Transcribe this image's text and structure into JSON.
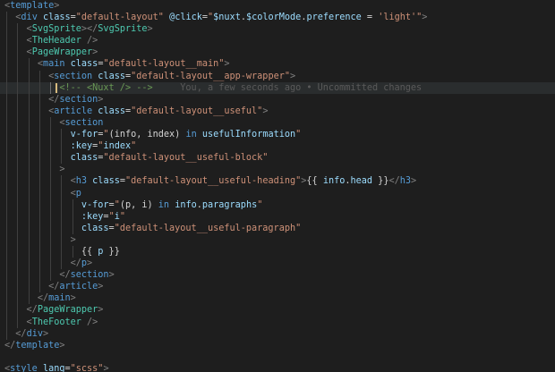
{
  "editor": {
    "lines": [
      {
        "indent": 0,
        "guides": [],
        "tokens": [
          [
            "<",
            "punc"
          ],
          [
            "template",
            "tag"
          ],
          [
            ">",
            "punc"
          ]
        ]
      },
      {
        "indent": 1,
        "guides": [
          0
        ],
        "tokens": [
          [
            "<",
            "punc"
          ],
          [
            "div",
            "tag"
          ],
          [
            " ",
            "txt"
          ],
          [
            "class",
            "attr"
          ],
          [
            "=",
            "txt"
          ],
          [
            "\"default-layout\"",
            "str"
          ],
          [
            " ",
            "txt"
          ],
          [
            "@click",
            "attr"
          ],
          [
            "=",
            "txt"
          ],
          [
            "\"",
            "str"
          ],
          [
            "$nuxt",
            "var"
          ],
          [
            ".",
            "txt"
          ],
          [
            "$colorMode",
            "var"
          ],
          [
            ".",
            "txt"
          ],
          [
            "preference",
            "var"
          ],
          [
            " = ",
            "txt"
          ],
          [
            "'light'",
            "str"
          ],
          [
            "\"",
            "str"
          ],
          [
            ">",
            "punc"
          ]
        ]
      },
      {
        "indent": 2,
        "guides": [
          0,
          1
        ],
        "tokens": [
          [
            "<",
            "punc"
          ],
          [
            "SvgSprite",
            "comp"
          ],
          [
            "></",
            "punc"
          ],
          [
            "SvgSprite",
            "comp"
          ],
          [
            ">",
            "punc"
          ]
        ]
      },
      {
        "indent": 2,
        "guides": [
          0,
          1
        ],
        "tokens": [
          [
            "<",
            "punc"
          ],
          [
            "TheHeader",
            "comp"
          ],
          [
            " />",
            "punc"
          ]
        ]
      },
      {
        "indent": 2,
        "guides": [
          0,
          1
        ],
        "tokens": [
          [
            "<",
            "punc"
          ],
          [
            "PageWrapper",
            "comp"
          ],
          [
            ">",
            "punc"
          ]
        ]
      },
      {
        "indent": 3,
        "guides": [
          0,
          1,
          2
        ],
        "tokens": [
          [
            "<",
            "punc"
          ],
          [
            "main",
            "tag"
          ],
          [
            " ",
            "txt"
          ],
          [
            "class",
            "attr"
          ],
          [
            "=",
            "txt"
          ],
          [
            "\"default-layout__main\"",
            "str"
          ],
          [
            ">",
            "punc"
          ]
        ]
      },
      {
        "indent": 4,
        "guides": [
          0,
          1,
          2,
          3
        ],
        "tokens": [
          [
            "<",
            "punc"
          ],
          [
            "section",
            "tag"
          ],
          [
            " ",
            "txt"
          ],
          [
            "class",
            "attr"
          ],
          [
            "=",
            "txt"
          ],
          [
            "\"default-layout__app-wrapper\"",
            "str"
          ],
          [
            ">",
            "punc"
          ]
        ]
      },
      {
        "indent": 5,
        "guides": [
          0,
          1,
          2,
          3,
          4
        ],
        "current": true,
        "cursor": true,
        "tokens": [
          [
            "<!-- <Nuxt /> -->",
            "cmt"
          ],
          [
            "     You, a few seconds ago • Uncommitted changes",
            "blame"
          ]
        ]
      },
      {
        "indent": 4,
        "guides": [
          0,
          1,
          2,
          3
        ],
        "tokens": [
          [
            "</",
            "punc"
          ],
          [
            "section",
            "tag"
          ],
          [
            ">",
            "punc"
          ]
        ]
      },
      {
        "indent": 4,
        "guides": [
          0,
          1,
          2,
          3
        ],
        "tokens": [
          [
            "<",
            "punc"
          ],
          [
            "article",
            "tag"
          ],
          [
            " ",
            "txt"
          ],
          [
            "class",
            "attr"
          ],
          [
            "=",
            "txt"
          ],
          [
            "\"default-layout__useful\"",
            "str"
          ],
          [
            ">",
            "punc"
          ]
        ]
      },
      {
        "indent": 5,
        "guides": [
          0,
          1,
          2,
          3,
          4
        ],
        "tokens": [
          [
            "<",
            "punc"
          ],
          [
            "section",
            "tag"
          ]
        ]
      },
      {
        "indent": 6,
        "guides": [
          0,
          1,
          2,
          3,
          4,
          5
        ],
        "tokens": [
          [
            "v-for",
            "attr"
          ],
          [
            "=",
            "txt"
          ],
          [
            "\"",
            "str"
          ],
          [
            "(info, index) ",
            "txt"
          ],
          [
            "in",
            "kw"
          ],
          [
            " ",
            "txt"
          ],
          [
            "usefulInformation",
            "var"
          ],
          [
            "\"",
            "str"
          ]
        ]
      },
      {
        "indent": 6,
        "guides": [
          0,
          1,
          2,
          3,
          4,
          5
        ],
        "tokens": [
          [
            ":key",
            "attr"
          ],
          [
            "=",
            "txt"
          ],
          [
            "\"",
            "str"
          ],
          [
            "index",
            "var"
          ],
          [
            "\"",
            "str"
          ]
        ]
      },
      {
        "indent": 6,
        "guides": [
          0,
          1,
          2,
          3,
          4,
          5
        ],
        "tokens": [
          [
            "class",
            "attr"
          ],
          [
            "=",
            "txt"
          ],
          [
            "\"default-layout__useful-block\"",
            "str"
          ]
        ]
      },
      {
        "indent": 5,
        "guides": [
          0,
          1,
          2,
          3,
          4
        ],
        "tokens": [
          [
            ">",
            "punc"
          ]
        ]
      },
      {
        "indent": 6,
        "guides": [
          0,
          1,
          2,
          3,
          4,
          5
        ],
        "tokens": [
          [
            "<",
            "punc"
          ],
          [
            "h3",
            "tag"
          ],
          [
            " ",
            "txt"
          ],
          [
            "class",
            "attr"
          ],
          [
            "=",
            "txt"
          ],
          [
            "\"default-layout__useful-heading\"",
            "str"
          ],
          [
            ">",
            "punc"
          ],
          [
            "{{ ",
            "txt"
          ],
          [
            "info",
            "var"
          ],
          [
            ".",
            "txt"
          ],
          [
            "head",
            "var"
          ],
          [
            " }}",
            "txt"
          ],
          [
            "</",
            "punc"
          ],
          [
            "h3",
            "tag"
          ],
          [
            ">",
            "punc"
          ]
        ]
      },
      {
        "indent": 6,
        "guides": [
          0,
          1,
          2,
          3,
          4,
          5
        ],
        "tokens": [
          [
            "<",
            "punc"
          ],
          [
            "p",
            "tag"
          ]
        ]
      },
      {
        "indent": 7,
        "guides": [
          0,
          1,
          2,
          3,
          4,
          5,
          6
        ],
        "tokens": [
          [
            "v-for",
            "attr"
          ],
          [
            "=",
            "txt"
          ],
          [
            "\"",
            "str"
          ],
          [
            "(p, i) ",
            "txt"
          ],
          [
            "in",
            "kw"
          ],
          [
            " ",
            "txt"
          ],
          [
            "info",
            "var"
          ],
          [
            ".",
            "txt"
          ],
          [
            "paragraphs",
            "var"
          ],
          [
            "\"",
            "str"
          ]
        ]
      },
      {
        "indent": 7,
        "guides": [
          0,
          1,
          2,
          3,
          4,
          5,
          6
        ],
        "tokens": [
          [
            ":key",
            "attr"
          ],
          [
            "=",
            "txt"
          ],
          [
            "\"",
            "str"
          ],
          [
            "i",
            "var"
          ],
          [
            "\"",
            "str"
          ]
        ]
      },
      {
        "indent": 7,
        "guides": [
          0,
          1,
          2,
          3,
          4,
          5,
          6
        ],
        "tokens": [
          [
            "class",
            "attr"
          ],
          [
            "=",
            "txt"
          ],
          [
            "\"default-layout__useful-paragraph\"",
            "str"
          ]
        ]
      },
      {
        "indent": 6,
        "guides": [
          0,
          1,
          2,
          3,
          4,
          5
        ],
        "tokens": [
          [
            ">",
            "punc"
          ]
        ]
      },
      {
        "indent": 7,
        "guides": [
          0,
          1,
          2,
          3,
          4,
          5,
          6
        ],
        "tokens": [
          [
            "{{ ",
            "txt"
          ],
          [
            "p",
            "var"
          ],
          [
            " }}",
            "txt"
          ]
        ]
      },
      {
        "indent": 6,
        "guides": [
          0,
          1,
          2,
          3,
          4,
          5
        ],
        "tokens": [
          [
            "</",
            "punc"
          ],
          [
            "p",
            "tag"
          ],
          [
            ">",
            "punc"
          ]
        ]
      },
      {
        "indent": 5,
        "guides": [
          0,
          1,
          2,
          3,
          4
        ],
        "tokens": [
          [
            "</",
            "punc"
          ],
          [
            "section",
            "tag"
          ],
          [
            ">",
            "punc"
          ]
        ]
      },
      {
        "indent": 4,
        "guides": [
          0,
          1,
          2,
          3
        ],
        "tokens": [
          [
            "</",
            "punc"
          ],
          [
            "article",
            "tag"
          ],
          [
            ">",
            "punc"
          ]
        ]
      },
      {
        "indent": 3,
        "guides": [
          0,
          1,
          2
        ],
        "tokens": [
          [
            "</",
            "punc"
          ],
          [
            "main",
            "tag"
          ],
          [
            ">",
            "punc"
          ]
        ]
      },
      {
        "indent": 2,
        "guides": [
          0,
          1
        ],
        "tokens": [
          [
            "</",
            "punc"
          ],
          [
            "PageWrapper",
            "comp"
          ],
          [
            ">",
            "punc"
          ]
        ]
      },
      {
        "indent": 2,
        "guides": [
          0,
          1
        ],
        "tokens": [
          [
            "<",
            "punc"
          ],
          [
            "TheFooter",
            "comp"
          ],
          [
            " />",
            "punc"
          ]
        ]
      },
      {
        "indent": 1,
        "guides": [
          0
        ],
        "tokens": [
          [
            "</",
            "punc"
          ],
          [
            "div",
            "tag"
          ],
          [
            ">",
            "punc"
          ]
        ]
      },
      {
        "indent": 0,
        "guides": [],
        "tokens": [
          [
            "</",
            "punc"
          ],
          [
            "template",
            "tag"
          ],
          [
            ">",
            "punc"
          ]
        ]
      },
      {
        "indent": 0,
        "guides": [],
        "tokens": []
      },
      {
        "indent": 0,
        "guides": [],
        "tokens": [
          [
            "<",
            "punc"
          ],
          [
            "style",
            "tag"
          ],
          [
            " ",
            "txt"
          ],
          [
            "lang",
            "attr"
          ],
          [
            "=",
            "txt"
          ],
          [
            "\"scss\"",
            "str"
          ],
          [
            ">",
            "punc"
          ]
        ]
      }
    ]
  }
}
